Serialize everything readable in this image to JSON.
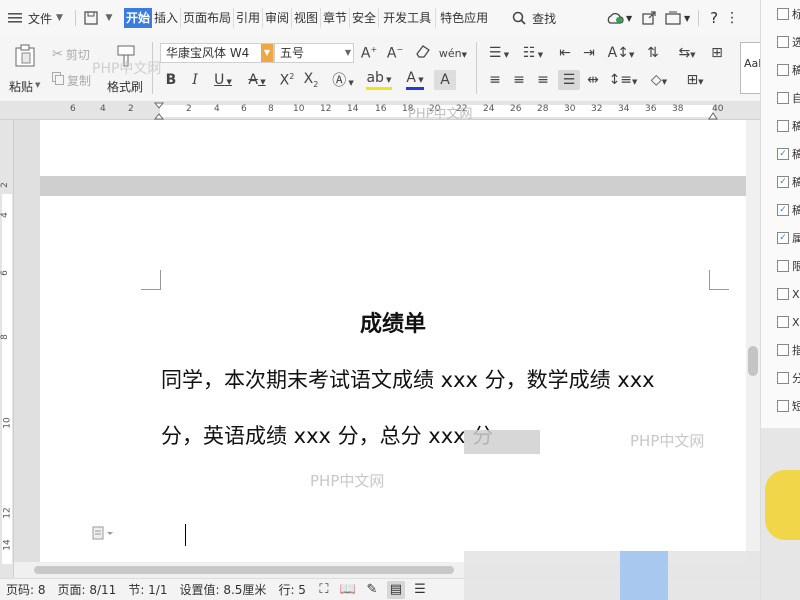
{
  "menubar": {
    "file_label": "文件",
    "tabs": [
      "开始",
      "插入",
      "页面布局",
      "引用",
      "审阅",
      "视图",
      "章节",
      "安全",
      "开发工具",
      "特色应用"
    ],
    "search_label": "查找"
  },
  "ribbon": {
    "paste_label": "粘贴",
    "cut_label": "剪切",
    "copy_label": "复制",
    "format_painter_label": "格式刷",
    "font_name": "华康宝风体 W4",
    "font_size": "五号",
    "style_preview": "AaI",
    "watermark": "PHP中文网"
  },
  "ruler": {
    "numbers": [
      "6",
      "4",
      "2",
      "2",
      "4",
      "6",
      "8",
      "10",
      "12",
      "14",
      "16",
      "18",
      "20",
      "22",
      "24",
      "26",
      "28",
      "30",
      "32",
      "34",
      "36",
      "38",
      "40"
    ]
  },
  "vruler": {
    "numbers": [
      "2",
      "4",
      "6",
      "8",
      "10",
      "12",
      "14"
    ]
  },
  "document": {
    "title": "成绩单",
    "line1": "同学，本次期末考试语文成绩 xxx 分，数学成绩 xxx",
    "line2": "分，英语成绩 xxx 分，总分 xxx 分",
    "watermark_a": "PHP中文网",
    "watermark_b": "PHP中文网"
  },
  "statusbar": {
    "page_code": "页码: 8",
    "page": "页面: 8/11",
    "section": "节: 1/1",
    "setting": "设置值: 8.5厘米",
    "line": "行: 5"
  },
  "rpanel": {
    "items": [
      {
        "label": "标",
        "checked": false
      },
      {
        "label": "选",
        "checked": false
      },
      {
        "label": "稿",
        "checked": false
      },
      {
        "label": "自",
        "checked": false
      },
      {
        "label": "稿",
        "checked": false
      },
      {
        "label": "稿",
        "checked": true
      },
      {
        "label": "稿",
        "checked": true
      },
      {
        "label": "稿",
        "checked": true
      },
      {
        "label": "属",
        "checked": true
      },
      {
        "label": "限",
        "checked": false
      },
      {
        "label": "X",
        "checked": false
      },
      {
        "label": "X",
        "checked": false
      },
      {
        "label": "指",
        "checked": false
      },
      {
        "label": "分",
        "checked": false
      },
      {
        "label": "短",
        "checked": false
      }
    ]
  },
  "colors": {
    "accent": "#3b7ddd",
    "font_color": "#1a44c8",
    "highlight": "#f2e31a",
    "font_size_arrow": "#f0a642"
  }
}
